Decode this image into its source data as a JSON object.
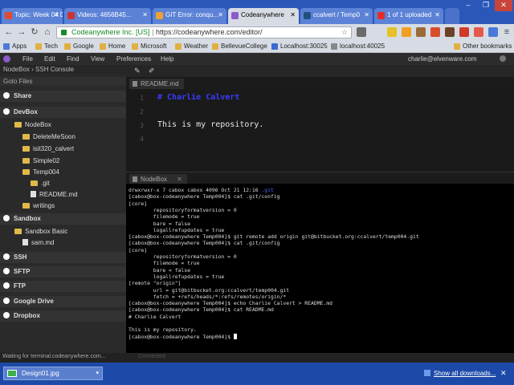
{
  "browser": {
    "tabs": [
      {
        "title": "Topic: Week 04 D"
      },
      {
        "title": "Videos: 4656B45..."
      },
      {
        "title": "GIT Error: conqu..."
      },
      {
        "title": "Codeanywhere"
      },
      {
        "title": "ccalvert / Temp0"
      },
      {
        "title": "1 of 1 uploaded"
      }
    ],
    "window_controls": {
      "minimize": "–",
      "restore": "❐",
      "close": "✕"
    },
    "url_owner": "Codeanywhere Inc. [US]",
    "url": "https://codeanywhere.com/editor/",
    "bookmarks": [
      "Apps",
      "Tech",
      "Google",
      "Home",
      "Microsoft",
      "Weather",
      "BellevueCollege",
      "Localhost:30025",
      "localhost:40025"
    ],
    "other_bookmarks": "Other bookmarks",
    "accent": "#2b58b8"
  },
  "app": {
    "menu": [
      "File",
      "Edit",
      "Find",
      "View",
      "Preferences",
      "Help"
    ],
    "user": "charlie@elvenware.com",
    "panel_title": "NodeBox › SSH Console",
    "goto_files": "Goto Files"
  },
  "sidebar": {
    "share": "Share",
    "devbox": "DevBox",
    "nodebox": "NodeBox",
    "nodebox_items": [
      "DeleteMeSoon",
      "isit320_calvert",
      "Simple02",
      "Temp004"
    ],
    "temp004_items": [
      ".git",
      "README.md"
    ],
    "writings": "writings",
    "sandbox": "Sandbox",
    "sandbox_basic": "Sandbox Basic",
    "sam_md": "sam.md",
    "ssh": "SSH",
    "sftp": "SFTP",
    "ftp": "FTP",
    "google_drive": "Google Drive",
    "dropbox": "Dropbox"
  },
  "editor": {
    "tab_label": "README.md",
    "lines": [
      "# Charlie Calvert",
      "",
      "This is my repository.",
      ""
    ],
    "line_numbers": [
      "1",
      "2",
      "3",
      "4"
    ]
  },
  "terminal": {
    "tab_label": "NodeBox",
    "lines": [
      "drwxrwxr-x 7 cabox cabox 4096 Oct 21 12:16 .git",
      "[cabox@box-codeanywhere Temp004]$ cat .git/config",
      "[core]",
      "        repositoryformatversion = 0",
      "        filemode = true",
      "        bare = false",
      "        logallrefupdates = true",
      "[cabox@box-codeanywhere Temp004]$ git remote add origin git@bitbucket.org:ccalvert/temp004.git",
      "[cabox@box-codeanywhere Temp004]$ cat .git/config",
      "[core]",
      "        repositoryformatversion = 0",
      "        filemode = true",
      "        bare = false",
      "        logallrefupdates = true",
      "[remote \"origin\"]",
      "        url = git@bitbucket.org:ccalvert/temp004.git",
      "        fetch = +refs/heads/*:refs/remotes/origin/*",
      "[cabox@box-codeanywhere Temp004]$ echo Charlie Calvert > README.md",
      "[cabox@box-codeanywhere Temp004]$ cat README.md",
      "# Charlie Calvert",
      "",
      "This is my repository.",
      "[cabox@box-codeanywhere Temp004]$ "
    ]
  },
  "status": {
    "text": "Waiting for terminal.codeanywhere.com...",
    "connection": "Connected"
  },
  "downloads": {
    "file": "Design01.jpg",
    "show_all": "Show all downloads...",
    "close": "✕"
  }
}
